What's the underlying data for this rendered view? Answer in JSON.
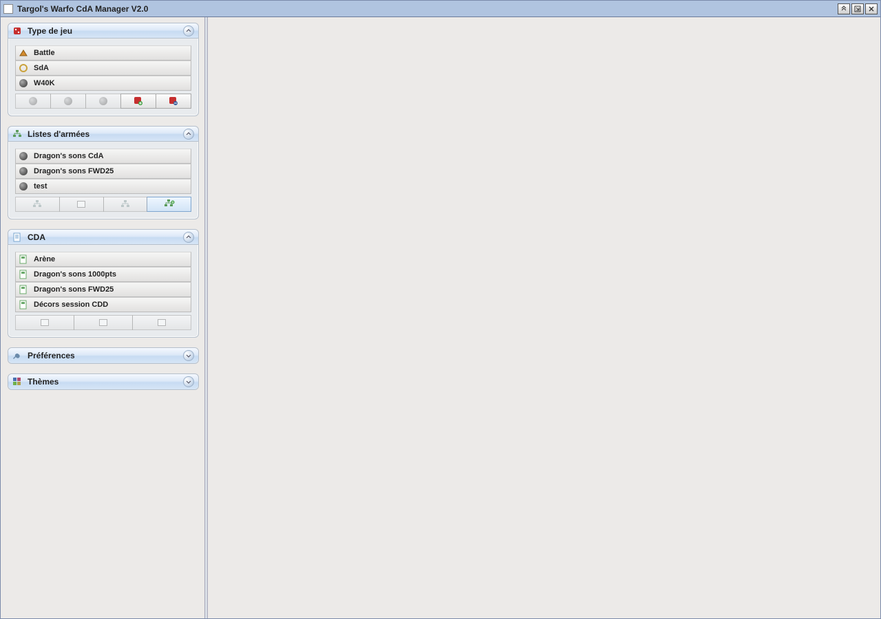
{
  "window": {
    "title": "Targol's Warfo CdA Manager V2.0"
  },
  "panels": {
    "gametype": {
      "title": "Type de jeu",
      "expanded": true,
      "items": [
        {
          "label": "Battle",
          "icon": "battle-icon"
        },
        {
          "label": "SdA",
          "icon": "sda-icon"
        },
        {
          "label": "W40K",
          "icon": "w40k-icon"
        }
      ],
      "toolbar": [
        "disabled",
        "disabled",
        "disabled",
        "dice-red",
        "dice-blue"
      ]
    },
    "armylists": {
      "title": "Listes d'armées",
      "expanded": true,
      "items": [
        {
          "label": "Dragon's sons CdA",
          "icon": "orb-icon"
        },
        {
          "label": "Dragon's sons FWD25",
          "icon": "orb-icon"
        },
        {
          "label": "test",
          "icon": "orb-icon"
        }
      ],
      "toolbar": [
        "org-disabled",
        "doc-disabled",
        "org-disabled",
        "org-add"
      ]
    },
    "cda": {
      "title": "CDA",
      "expanded": true,
      "items": [
        {
          "label": "Arène",
          "icon": "page-icon"
        },
        {
          "label": "Dragon's sons 1000pts",
          "icon": "page-icon"
        },
        {
          "label": "Dragon's sons FWD25",
          "icon": "page-icon"
        },
        {
          "label": "Décors session CDD",
          "icon": "page-icon"
        }
      ],
      "toolbar": [
        "doc-disabled",
        "doc-disabled",
        "doc-disabled"
      ]
    },
    "prefs": {
      "title": "Préférences",
      "expanded": false
    },
    "themes": {
      "title": "Thèmes",
      "expanded": false
    }
  }
}
